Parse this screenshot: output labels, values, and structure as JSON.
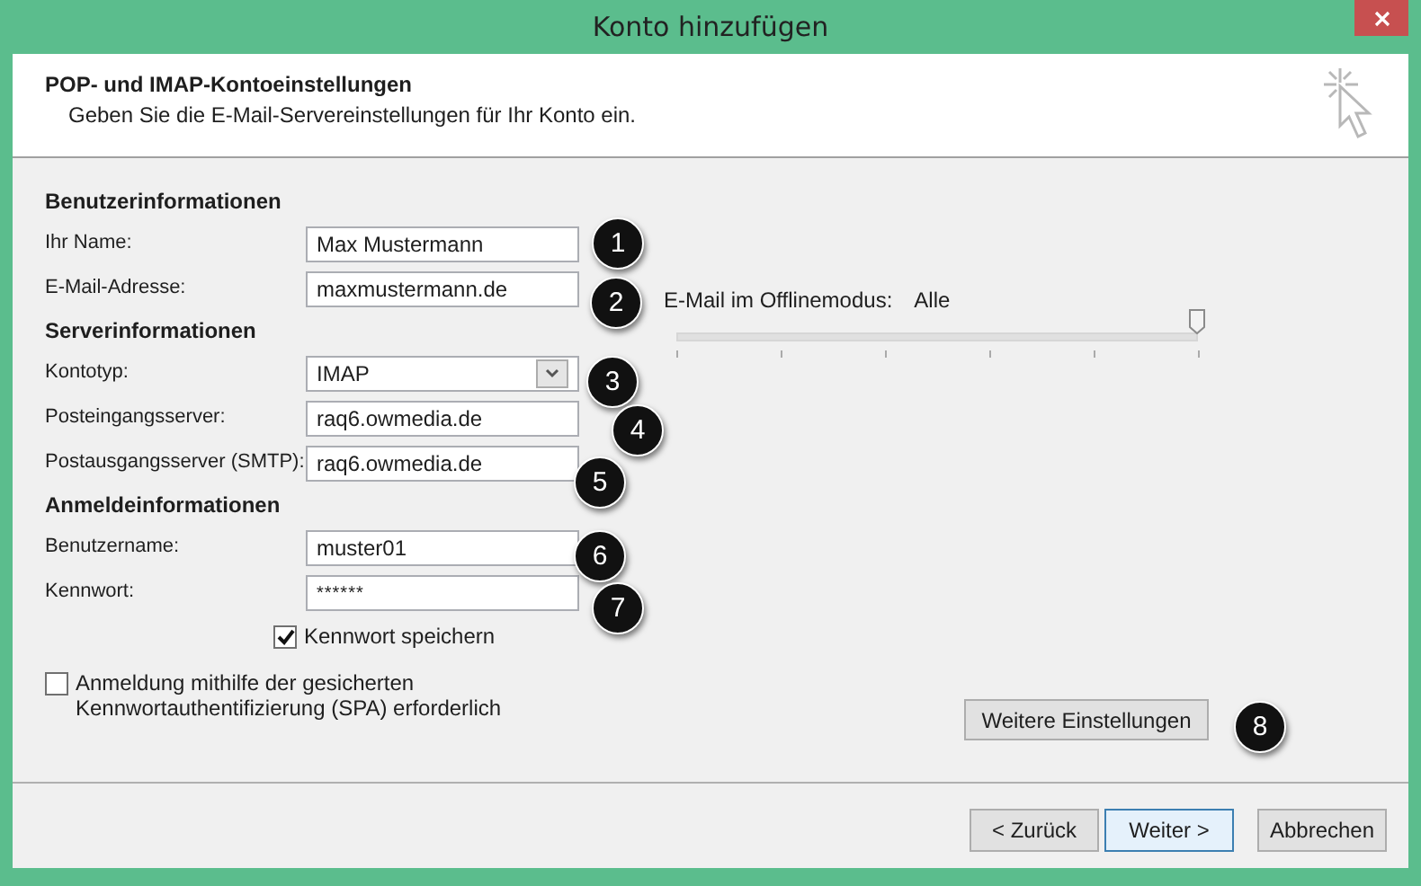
{
  "window": {
    "title": "Konto hinzufügen"
  },
  "header": {
    "title": "POP- und IMAP-Kontoeinstellungen",
    "subtitle": "Geben Sie die E-Mail-Servereinstellungen für Ihr Konto ein."
  },
  "sections": [
    {
      "heading": "Benutzerinformationen",
      "fields": [
        {
          "kind": "text",
          "label": "Ihr Name:",
          "value": "Max Mustermann",
          "callout": "1"
        },
        {
          "kind": "text",
          "label": "E-Mail-Adresse:",
          "value": "maxmustermann.de",
          "callout": "2"
        }
      ]
    },
    {
      "heading": "Serverinformationen",
      "fields": [
        {
          "kind": "dropdown",
          "label": "Kontotyp:",
          "value": "IMAP",
          "callout": "3"
        },
        {
          "kind": "text",
          "label": "Posteingangsserver:",
          "value": "raq6.owmedia.de",
          "callout": "4"
        },
        {
          "kind": "text",
          "label": "Postausgangsserver (SMTP):",
          "value": "raq6.owmedia.de",
          "callout": "5"
        }
      ]
    },
    {
      "heading": "Anmeldeinformationen",
      "fields": [
        {
          "kind": "text",
          "label": "Benutzername:",
          "value": "muster01",
          "callout": "6"
        },
        {
          "kind": "password",
          "label": "Kennwort:",
          "value": "******",
          "callout": "7"
        }
      ]
    }
  ],
  "remember_password": {
    "label": "Kennwort speichern",
    "checked": true
  },
  "spa": {
    "label": "Anmeldung mithilfe der gesicherten Kennwortauthentifizierung (SPA) erforderlich",
    "checked": false
  },
  "offline": {
    "label": "E-Mail im Offlinemodus:",
    "value": "Alle",
    "level": 1
  },
  "more_settings": {
    "label": "Weitere Einstellungen",
    "callout": "8"
  },
  "buttons": [
    {
      "label": "< Zurück",
      "selected": false
    },
    {
      "label": "Weiter >",
      "selected": true
    },
    {
      "label": "Abbrechen",
      "selected": false
    }
  ]
}
